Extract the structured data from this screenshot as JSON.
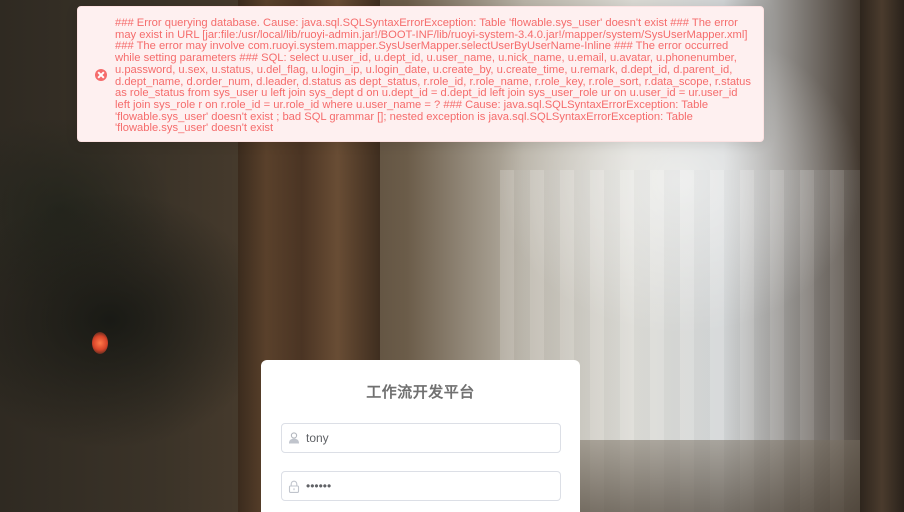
{
  "error": {
    "icon": "circle-close-icon",
    "color": "#f56c6c",
    "background": "#fef0f0",
    "message": "### Error querying database. Cause: java.sql.SQLSyntaxErrorException: Table 'flowable.sys_user' doesn't exist ### The error may exist in URL [jar:file:/usr/local/lib/ruoyi-admin.jar!/BOOT-INF/lib/ruoyi-system-3.4.0.jar!/mapper/system/SysUserMapper.xml] ### The error may involve com.ruoyi.system.mapper.SysUserMapper.selectUserByUserName-Inline ### The error occurred while setting parameters ### SQL: select u.user_id, u.dept_id, u.user_name, u.nick_name, u.email, u.avatar, u.phonenumber, u.password, u.sex, u.status, u.del_flag, u.login_ip, u.login_date, u.create_by, u.create_time, u.remark, d.dept_id, d.parent_id, d.dept_name, d.order_num, d.leader, d.status as dept_status, r.role_id, r.role_name, r.role_key, r.role_sort, r.data_scope, r.status as role_status from sys_user u left join sys_dept d on u.dept_id = d.dept_id left join sys_user_role ur on u.user_id = ur.user_id left join sys_role r on r.role_id = ur.role_id where u.user_name = ? ### Cause: java.sql.SQLSyntaxErrorException: Table 'flowable.sys_user' doesn't exist ; bad SQL grammar []; nested exception is java.sql.SQLSyntaxErrorException: Table 'flowable.sys_user' doesn't exist"
  },
  "login": {
    "title": "工作流开发平台",
    "username": {
      "icon": "user-icon",
      "value": "tony"
    },
    "password": {
      "icon": "lock-icon",
      "value": "••••••"
    }
  }
}
